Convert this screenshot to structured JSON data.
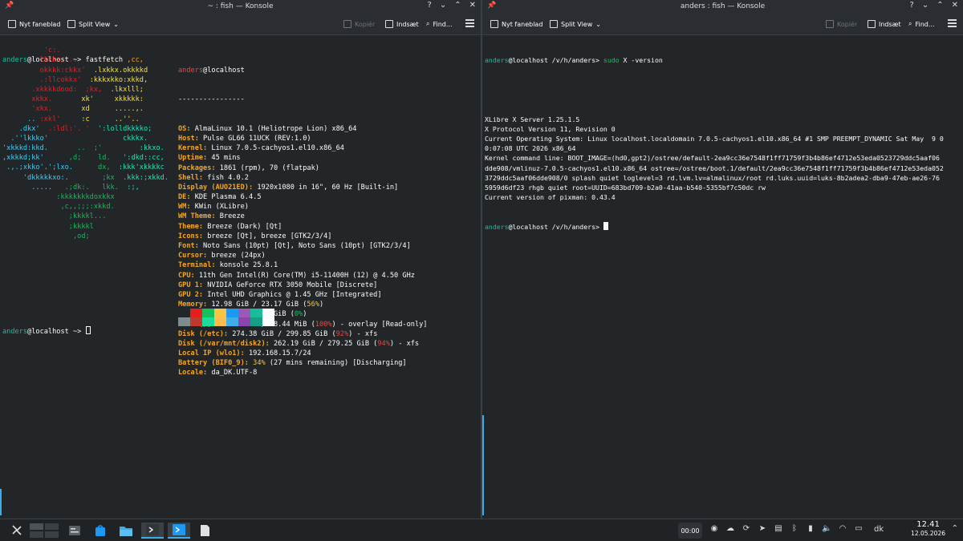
{
  "left_window": {
    "title": "~ : fish — Konsole",
    "toolbar": {
      "new_tab": "Nyt faneblad",
      "split_view": "Split View",
      "copy": "Kopiér",
      "paste": "Indsæt",
      "find": "Find..."
    },
    "prompt_user": "anders",
    "prompt_host": "@localhost",
    "prompt_path": " ~> ",
    "command": "fastfetch",
    "final_prompt_user": "anders",
    "final_prompt_host": "@localhost",
    "final_prompt_path": " ~> ",
    "logo_lines": [
      [
        [
          "          ",
          ""
        ],
        [
          "'c:.",
          "c1"
        ]
      ],
      [
        [
          "         ",
          ""
        ],
        [
          "lkkkx, ..",
          "c1"
        ],
        [
          "       ",
          ""
        ],
        [
          "..",
          "c2"
        ],
        [
          "   ",
          ""
        ],
        [
          ",cc,",
          "c2"
        ]
      ],
      [
        [
          "         ",
          ""
        ],
        [
          "okkkk:ckkx'",
          "c1"
        ],
        [
          "  ",
          ""
        ],
        [
          ".lxkkx.okkkkd",
          "c3"
        ]
      ],
      [
        [
          "         ",
          ""
        ],
        [
          ".:llcokkx'",
          "c1"
        ],
        [
          "  ",
          ""
        ],
        [
          ":kkkxkko:xkkd,",
          "c3"
        ]
      ],
      [
        [
          "       ",
          ""
        ],
        [
          ".xkkkkdood:",
          "c1"
        ],
        [
          "  ",
          ""
        ],
        [
          ";kx,",
          "c1"
        ],
        [
          "  ",
          ""
        ],
        [
          ".lkxlll;",
          "c3"
        ]
      ],
      [
        [
          "       ",
          ""
        ],
        [
          "xkkx.",
          "c1"
        ],
        [
          "       ",
          ""
        ],
        [
          "xk'",
          "c3"
        ],
        [
          "     ",
          ""
        ],
        [
          "xkkkkk:",
          "c3"
        ]
      ],
      [
        [
          "       ",
          ""
        ],
        [
          "'xkx.",
          "c1"
        ],
        [
          "       ",
          ""
        ],
        [
          "xd",
          "c3"
        ],
        [
          "      ",
          ""
        ],
        [
          ".....,.",
          "c3"
        ]
      ],
      [
        [
          "      ",
          ""
        ],
        [
          "..",
          "c4"
        ],
        [
          " :xkl'",
          "c1"
        ],
        [
          "     ",
          ""
        ],
        [
          ":c",
          "c3"
        ],
        [
          "      ",
          ""
        ],
        [
          "..''..",
          "c3"
        ]
      ],
      [
        [
          "    ",
          ""
        ],
        [
          ".dkx'",
          "c4"
        ],
        [
          "  ",
          ""
        ],
        [
          ".:ldl:'. '",
          "c1"
        ],
        [
          "  ",
          ""
        ],
        [
          "':lolldkkkko;",
          "c5"
        ]
      ],
      [
        [
          "  ",
          ""
        ],
        [
          ".''lkkko'",
          "c4"
        ],
        [
          "                  ",
          ""
        ],
        [
          "ckkkx.",
          "c5"
        ]
      ],
      [
        [
          "",
          ""
        ],
        [
          "'xkkkd:kkd.",
          "c4"
        ],
        [
          "       ",
          ""
        ],
        [
          "..",
          "c6"
        ],
        [
          "  ",
          ""
        ],
        [
          ";'",
          "c6"
        ],
        [
          "         ",
          ""
        ],
        [
          ":kkxo.",
          "c5"
        ]
      ],
      [
        [
          "",
          ""
        ],
        [
          ",xkkkd;kk'",
          "c4"
        ],
        [
          "      ",
          ""
        ],
        [
          ",d;",
          "c6"
        ],
        [
          "    ",
          ""
        ],
        [
          "ld.",
          "c6"
        ],
        [
          "   ",
          ""
        ],
        [
          "':dkd::cc,",
          "c5"
        ]
      ],
      [
        [
          "",
          ""
        ],
        [
          " .,.;xkko'.';lxo.",
          "c4"
        ],
        [
          "      ",
          ""
        ],
        [
          "dx,",
          "c6"
        ],
        [
          "  ",
          ""
        ],
        [
          ":kkk'xkkkkc",
          "c5"
        ]
      ],
      [
        [
          "     ",
          ""
        ],
        [
          "'dkkkkkxo:.",
          "c4"
        ],
        [
          "        ",
          ""
        ],
        [
          ";kx",
          "c6"
        ],
        [
          "  ",
          ""
        ],
        [
          ".kkk:;xkkd.",
          "c5"
        ]
      ],
      [
        [
          "       ",
          ""
        ],
        [
          ".....",
          "c4"
        ],
        [
          "   ",
          ""
        ],
        [
          ".;dk:.",
          "c6"
        ],
        [
          "   ",
          ""
        ],
        [
          "lkk.",
          "c6"
        ],
        [
          "  ",
          ""
        ],
        [
          ":;,",
          "c5"
        ]
      ],
      [
        [
          "             ",
          ""
        ],
        [
          ":kkkkkkkdoxkkx",
          "c6"
        ]
      ],
      [
        [
          "              ",
          ""
        ],
        [
          ",c,,;;;:xkkd.",
          "c6"
        ]
      ],
      [
        [
          "                ",
          ""
        ],
        [
          ";kkkkl...",
          "c6"
        ]
      ],
      [
        [
          "                ",
          ""
        ],
        [
          ";kkkkl",
          "c6"
        ]
      ],
      [
        [
          "                 ",
          ""
        ],
        [
          ",od;",
          "c6"
        ]
      ]
    ],
    "info_user": "anders",
    "info_host": "@localhost",
    "separator": "----------------",
    "info": [
      [
        [
          "OS:",
          "k"
        ],
        [
          " AlmaLinux 10.1 (Heliotrope Lion) x86_64",
          ""
        ]
      ],
      [
        [
          "Host:",
          "k"
        ],
        [
          " Pulse GL66 11UCK (REV:1.0)",
          ""
        ]
      ],
      [
        [
          "Kernel:",
          "k"
        ],
        [
          " Linux 7.0.5-cachyos1.el10.x86_64",
          ""
        ]
      ],
      [
        [
          "Uptime:",
          "k"
        ],
        [
          " 45 mins",
          ""
        ]
      ],
      [
        [
          "Packages:",
          "k"
        ],
        [
          " 1861 (rpm), 70 (flatpak)",
          ""
        ]
      ],
      [
        [
          "Shell:",
          "k"
        ],
        [
          " fish 4.0.2",
          ""
        ]
      ],
      [
        [
          "Display (AUO21ED):",
          "k"
        ],
        [
          " 1920x1080 in 16\", 60 Hz [Built-in]",
          ""
        ]
      ],
      [
        [
          "DE:",
          "k"
        ],
        [
          " KDE Plasma 6.4.5",
          ""
        ]
      ],
      [
        [
          "WM:",
          "k"
        ],
        [
          " KWin (XLibre)",
          ""
        ]
      ],
      [
        [
          "WM Theme:",
          "k"
        ],
        [
          " Breeze",
          ""
        ]
      ],
      [
        [
          "Theme:",
          "k"
        ],
        [
          " Breeze (Dark) [Qt]",
          ""
        ]
      ],
      [
        [
          "Icons:",
          "k"
        ],
        [
          " breeze [Qt], breeze [GTK2/3/4]",
          ""
        ]
      ],
      [
        [
          "Font:",
          "k"
        ],
        [
          " Noto Sans (10pt) [Qt], Noto Sans (10pt) [GTK2/3/4]",
          ""
        ]
      ],
      [
        [
          "Cursor:",
          "k"
        ],
        [
          " breeze (24px)",
          ""
        ]
      ],
      [
        [
          "Terminal:",
          "k"
        ],
        [
          " konsole 25.8.1",
          ""
        ]
      ],
      [
        [
          "CPU:",
          "k"
        ],
        [
          " 11th Gen Intel(R) Core(TM) i5-11400H (12) @ 4.50 GHz",
          ""
        ]
      ],
      [
        [
          "GPU 1:",
          "k"
        ],
        [
          " NVIDIA GeForce RTX 3050 Mobile [Discrete]",
          ""
        ]
      ],
      [
        [
          "GPU 2:",
          "k"
        ],
        [
          " Intel UHD Graphics @ 1.45 GHz [Integrated]",
          ""
        ]
      ],
      [
        [
          "Memory:",
          "k"
        ],
        [
          " 12.98 GiB / 23.17 GiB (",
          ""
        ],
        [
          "56%",
          "y"
        ],
        [
          ")",
          ""
        ]
      ],
      [
        [
          "Swap:",
          "k"
        ],
        [
          " 1.18 MiB / 23.17 GiB (",
          ""
        ],
        [
          "0%",
          "g"
        ],
        [
          ")",
          ""
        ]
      ],
      [
        [
          "Disk (/):",
          "k"
        ],
        [
          " 38.44 MiB / 38.44 MiB (",
          ""
        ],
        [
          "100%",
          "r"
        ],
        [
          ") - overlay [Read-only]",
          ""
        ]
      ],
      [
        [
          "Disk (/etc):",
          "k"
        ],
        [
          " 274.38 GiB / 299.85 GiB (",
          ""
        ],
        [
          "92%",
          "r"
        ],
        [
          ") - xfs",
          ""
        ]
      ],
      [
        [
          "Disk (/var/mnt/disk2):",
          "k"
        ],
        [
          " 262.19 GiB / 279.25 GiB (",
          ""
        ],
        [
          "94%",
          "r"
        ],
        [
          ") - xfs",
          ""
        ]
      ],
      [
        [
          "Local IP (wlo1):",
          "k"
        ],
        [
          " 192.168.15.7/24",
          ""
        ]
      ],
      [
        [
          "Battery (BIF0_9):",
          "k"
        ],
        [
          " ",
          ""
        ],
        [
          "34%",
          "y"
        ],
        [
          " (27 mins remaining) [Discharging]",
          ""
        ]
      ],
      [
        [
          "Locale:",
          "k"
        ],
        [
          " da_DK.UTF-8",
          ""
        ]
      ]
    ],
    "palette_top": [
      "#232629",
      "#e81e1e",
      "#18c05b",
      "#f6c543",
      "#1d99f3",
      "#9b59b6",
      "#1abc9c",
      "#fcfcfc"
    ],
    "palette_bottom": [
      "#7f8c8d",
      "#c0392b",
      "#1cdc9a",
      "#fdbc4b",
      "#3daee9",
      "#8e44ad",
      "#16a085",
      "#ffffff"
    ]
  },
  "right_window": {
    "title": "anders : fish — Konsole",
    "toolbar": {
      "new_tab": "Nyt faneblad",
      "split_view": "Split View",
      "copy": "Kopiér",
      "paste": "Indsæt",
      "find": "Find..."
    },
    "prompt_user": "anders",
    "prompt_host": "@localhost",
    "prompt_path": " /v/h/anders> ",
    "command_bin": "sudo",
    "command_rest": " X -version",
    "output": [
      "XLibre X Server 1.25.1.5",
      "X Protocol Version 11, Revision 0",
      "Current Operating System: Linux localhost.localdomain 7.0.5-cachyos1.el10.x86_64 #1 SMP PREEMPT_DYNAMIC Sat May  9 0",
      "0:07:08 UTC 2026 x86_64",
      "Kernel command line: BOOT_IMAGE=(hd0,gpt2)/ostree/default-2ea9cc36e7548f1ff71759f3b4b86ef4712e53eda0523729ddc5aaf06",
      "dde908/vmlinuz-7.0.5-cachyos1.el10.x86_64 ostree=/ostree/boot.1/default/2ea9cc36e7548f1ff71759f3b4b86ef4712e53eda052",
      "3729ddc5aaf06dde908/0 splash quiet loglevel=3 rd.lvm.lv=almalinux/root rd.luks.uuid=luks-8b2adea2-dba9-47eb-ae26-76",
      "5959d6df23 rhgb quiet root=UUID=683bd709-b2a0-41aa-b540-5355bf7c50dc rw",
      "Current version of pixman: 0.43.4"
    ],
    "final_prompt_user": "anders",
    "final_prompt_host": "@localhost",
    "final_prompt_path": " /v/h/anders> "
  },
  "taskbar": {
    "timer": "00:00",
    "keyboard_layout": "dk",
    "time": "12.41",
    "date": "12.05.2026",
    "tray_icons": [
      "media-icon",
      "cloud-icon",
      "update-icon",
      "telegram-icon",
      "clipboard-icon",
      "bluetooth-icon",
      "battery-icon",
      "volume-icon",
      "wifi-icon",
      "display-icon"
    ]
  }
}
